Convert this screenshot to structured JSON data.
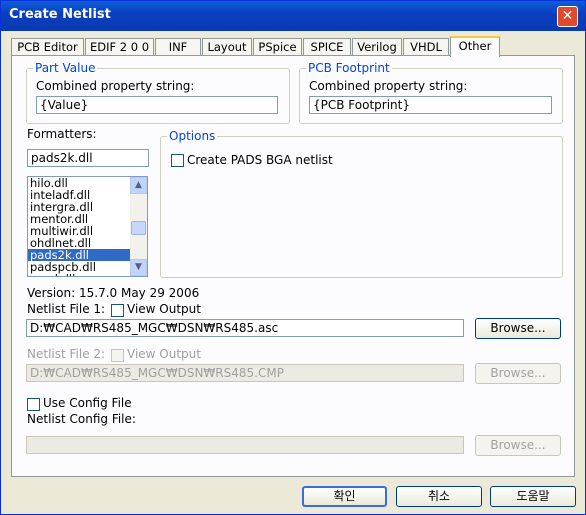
{
  "window": {
    "title": "Create Netlist",
    "close_label": "✕"
  },
  "tabs": [
    "PCB Editor",
    "EDIF 2 0 0",
    "INF",
    "Layout",
    "PSpice",
    "SPICE",
    "Verilog",
    "VHDL",
    "Other"
  ],
  "active_tab": "Other",
  "part_value": {
    "legend": "Part Value",
    "label": "Combined property string:",
    "value": "{Value}"
  },
  "pcb_footprint": {
    "legend": "PCB Footprint",
    "label": "Combined property string:",
    "value": "{PCB Footprint}"
  },
  "formatters": {
    "label": "Formatters:",
    "selected_value": "pads2k.dll",
    "items": [
      "hilo.dll",
      "inteladf.dll",
      "intergra.dll",
      "mentor.dll",
      "multiwir.dll",
      "ohdlnet.dll",
      "pads2k.dll",
      "padspcb.dll",
      "pcad.dll"
    ],
    "selected_index": 6
  },
  "options": {
    "legend": "Options",
    "create_pads_bga": "Create PADS BGA netlist"
  },
  "version": "Version: 15.7.0  May 29 2006",
  "netlist_file1": {
    "label": "Netlist File 1:",
    "view_output": "View Output",
    "value": "D:₩CAD₩RS485_MGC₩DSN₩RS485.asc",
    "browse": "Browse..."
  },
  "netlist_file2": {
    "label": "Netlist File 2:",
    "view_output": "View Output",
    "value": "D:₩CAD₩RS485_MGC₩DSN₩RS485.CMP",
    "browse": "Browse..."
  },
  "config": {
    "use_label": "Use Config File",
    "file_label": "Netlist Config File:",
    "value": "",
    "browse": "Browse..."
  },
  "buttons": {
    "ok": "확인",
    "cancel": "취소",
    "help": "도움말"
  }
}
